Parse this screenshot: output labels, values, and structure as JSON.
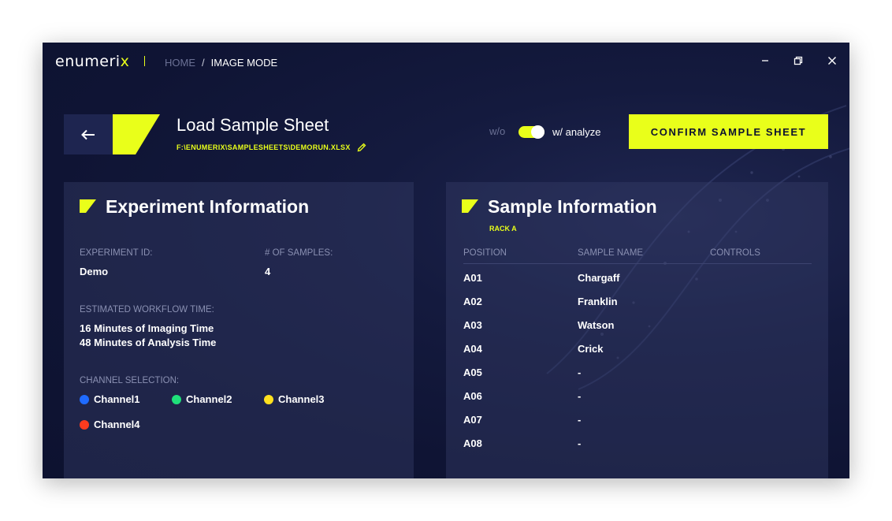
{
  "app": {
    "logo_prefix": "enumeri",
    "logo_suffix": "x"
  },
  "breadcrumb": {
    "home": "HOME",
    "separator": "/",
    "current": "IMAGE MODE"
  },
  "header": {
    "title": "Load Sample Sheet",
    "file_path": "F:\\ENUMERIX\\SAMPLESHEETS\\DEMORUN.XLSX",
    "toggle_off_label": "w/o",
    "toggle_on_label": "w/ analyze",
    "toggle_on": true,
    "confirm_label": "CONFIRM SAMPLE SHEET"
  },
  "experiment": {
    "title": "Experiment Information",
    "id_label": "EXPERIMENT ID:",
    "id_value": "Demo",
    "samples_label": "# OF SAMPLES:",
    "samples_value": "4",
    "workflow_label": "ESTIMATED WORKFLOW TIME:",
    "imaging_time": "16 Minutes of Imaging Time",
    "analysis_time": "48 Minutes of Analysis Time",
    "channel_label": "CHANNEL SELECTION:",
    "channels": [
      {
        "name": "Channel1",
        "color": "#1f6bff"
      },
      {
        "name": "Channel2",
        "color": "#1fe07a"
      },
      {
        "name": "Channel3",
        "color": "#ffe11f"
      },
      {
        "name": "Channel4",
        "color": "#ff3b1f"
      }
    ]
  },
  "samples": {
    "title": "Sample Information",
    "rack": "RACK A",
    "columns": [
      "POSITION",
      "SAMPLE NAME",
      "CONTROLS"
    ],
    "rows": [
      {
        "position": "A01",
        "name": "Chargaff",
        "controls": ""
      },
      {
        "position": "A02",
        "name": "Franklin",
        "controls": ""
      },
      {
        "position": "A03",
        "name": "Watson",
        "controls": ""
      },
      {
        "position": "A04",
        "name": "Crick",
        "controls": ""
      },
      {
        "position": "A05",
        "name": "-",
        "controls": ""
      },
      {
        "position": "A06",
        "name": "-",
        "controls": ""
      },
      {
        "position": "A07",
        "name": "-",
        "controls": ""
      },
      {
        "position": "A08",
        "name": "-",
        "controls": ""
      }
    ]
  },
  "colors": {
    "accent": "#e9ff1a",
    "background": "#0f1434",
    "panel": "#262c55"
  }
}
